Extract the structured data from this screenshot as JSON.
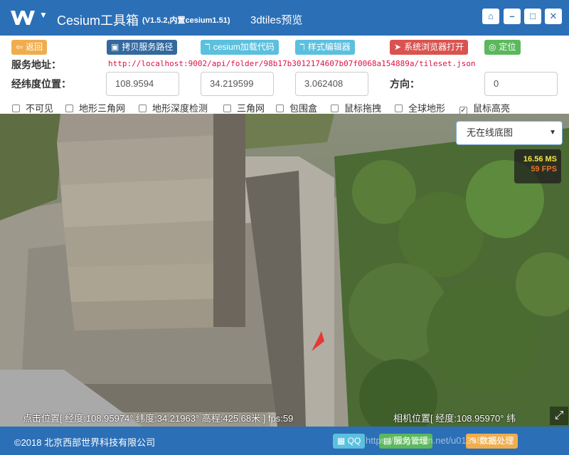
{
  "titlebar": {
    "app_name": "Cesium工具箱",
    "version": "(V1.5.2,内置cesium1.51)",
    "subtitle": "3dtiles预览",
    "color": "#2b6fb6",
    "window_buttons": [
      "home-icon",
      "minimize-icon",
      "maximize-icon",
      "close-icon"
    ]
  },
  "toolbar": {
    "back_label": "返回",
    "copy_path_label": "拷贝服务路径",
    "load_code_label": "cesium加载代码",
    "style_editor_label": "样式编辑器",
    "open_browser_label": "系统浏览器打开",
    "locate_label": "定位"
  },
  "service": {
    "label": "服务地址：",
    "url": "http://localhost:9002/api/folder/98b17b3012174607b07f0068a154889a/tileset.json"
  },
  "position": {
    "label": "经纬度位置：",
    "lon": "108.9594",
    "lat": "34.219599",
    "height": "3.062408",
    "heading_label": "方向：",
    "heading": "0"
  },
  "options": [
    {
      "label": "不可见",
      "checked": false
    },
    {
      "label": "地形三角网",
      "checked": false
    },
    {
      "label": "地形深度检测",
      "checked": false
    },
    {
      "label": "三角网",
      "checked": false
    },
    {
      "label": "包围盒",
      "checked": false
    },
    {
      "label": "鼠标拖拽",
      "checked": false
    },
    {
      "label": "全球地形",
      "checked": false
    },
    {
      "label": "鼠标高亮",
      "checked": true
    }
  ],
  "map": {
    "basemap_selected": "无在线底图",
    "fps_ms": "16.56 MS",
    "fps_value": "59 FPS",
    "click_status": "点击位置[ 经度:108.95974° 纬度:34.21963° 高程:425.68米 ] fps:59",
    "camera_status": "相机位置[ 经度:108.95970° 纬"
  },
  "footer": {
    "copyright": "©2018 北京西部世界科技有限公司",
    "qq_label": "QQ",
    "service_mgmt_label": "服务管理",
    "data_processing_label": "数据处理",
    "watermark": "https://blog.csdn.net/u01338235"
  }
}
